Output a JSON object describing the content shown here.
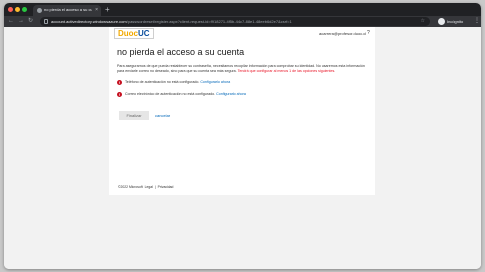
{
  "browser": {
    "tab_title": "no pierda el acceso a su cuent",
    "tab_close": "×",
    "new_tab": "+",
    "back_icon": "arrow-left-icon",
    "forward_icon": "arrow-right-icon",
    "reload_icon": "reload-icon",
    "url_host": "account.activedirectory.windowsazure.com",
    "url_path": "/passwordreset/register.aspx?client-request-id=f918271-4f5b-44c7-88e1-48eeb6d2e7&csrf=1",
    "star_icon": "star-icon",
    "incognito_label": "Incógnito",
    "menu_icon": "kebab-menu-icon",
    "window_dots": [
      "#ff5f57",
      "#febc2e",
      "#28c840"
    ]
  },
  "page": {
    "logo_part1": "Duoc",
    "logo_part2": "UC",
    "user_email": "acarrera@profesor.duoc.cl",
    "help": "?",
    "title": "no pierda el acceso a su cuenta",
    "description": "Para asegurarnos de que pueda restablecer su contraseña, necesitamos recopilar información para comprobar su identidad. No usaremos esta información para enviarle correo no deseado, sino para que su cuenta sea más segura.",
    "description_warning": "Tendrá que configurar al menos 1 de las opciones siguientes.",
    "methods": [
      {
        "text": "Teléfono de autenticación no está configurado.",
        "link": "Configurarlo ahora"
      },
      {
        "text": "Correo electrónico de autenticación no está configurado.",
        "link": "Configurarlo ahora"
      }
    ],
    "warn_glyph": "!",
    "finish_button": "Finalizar",
    "cancel_link": "cancelar",
    "footer": {
      "copyright": "©2022 Microsoft",
      "legal": "Legal",
      "privacy": "Privacidad",
      "sep": "|"
    }
  }
}
